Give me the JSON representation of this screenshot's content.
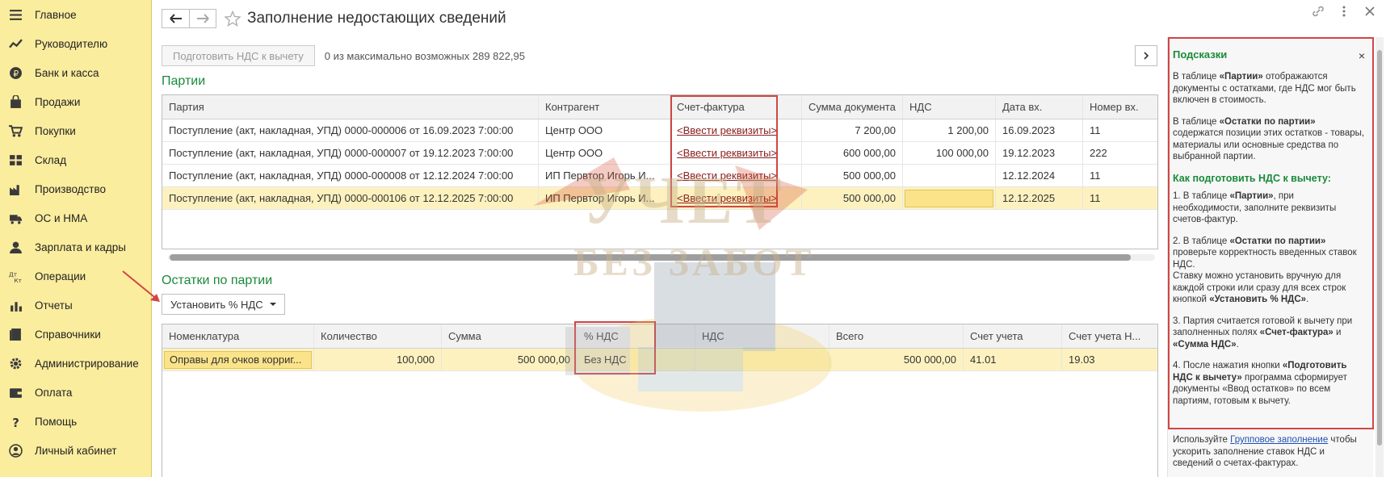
{
  "sidebar": {
    "items": [
      {
        "label": "Главное",
        "icon": "menu-icon"
      },
      {
        "label": "Руководителю",
        "icon": "trend-icon"
      },
      {
        "label": "Банк и касса",
        "icon": "ruble-icon"
      },
      {
        "label": "Продажи",
        "icon": "bag-icon"
      },
      {
        "label": "Покупки",
        "icon": "cart-icon"
      },
      {
        "label": "Склад",
        "icon": "warehouse-icon"
      },
      {
        "label": "Производство",
        "icon": "factory-icon"
      },
      {
        "label": "ОС и НМА",
        "icon": "truck-icon"
      },
      {
        "label": "Зарплата и кадры",
        "icon": "person-icon"
      },
      {
        "label": "Операции",
        "icon": "dt-kt-icon"
      },
      {
        "label": "Отчеты",
        "icon": "bar-chart-icon"
      },
      {
        "label": "Справочники",
        "icon": "book-icon"
      },
      {
        "label": "Администрирование",
        "icon": "gear-icon"
      },
      {
        "label": "Оплата",
        "icon": "wallet-icon"
      },
      {
        "label": "Помощь",
        "icon": "question-icon"
      },
      {
        "label": "Личный кабинет",
        "icon": "account-icon"
      }
    ]
  },
  "header": {
    "title": "Заполнение недостающих сведений"
  },
  "toolbar": {
    "prepare_label": "Подготовить НДС к вычету",
    "hint": "0 из максимально возможных 289 822,95"
  },
  "batches": {
    "title": "Партии",
    "columns": [
      "Партия",
      "Контрагент",
      "Счет-фактура",
      "Сумма документа",
      "НДС",
      "Дата вх.",
      "Номер вх."
    ],
    "rows": [
      {
        "party": "Поступление (акт, накладная, УПД) 0000-000006 от 16.09.2023 7:00:00",
        "counterparty": "Центр ООО",
        "invoice": "<Ввести реквизиты>",
        "amount": "7 200,00",
        "vat": "1 200,00",
        "date": "16.09.2023",
        "number": "11"
      },
      {
        "party": "Поступление (акт, накладная, УПД) 0000-000007 от 19.12.2023 7:00:00",
        "counterparty": "Центр ООО",
        "invoice": "<Ввести реквизиты>",
        "amount": "600 000,00",
        "vat": "100 000,00",
        "date": "19.12.2023",
        "number": "222"
      },
      {
        "party": "Поступление (акт, накладная, УПД) 0000-000008 от 12.12.2024 7:00:00",
        "counterparty": "ИП Первтор Игорь И...",
        "invoice": "<Ввести реквизиты>",
        "amount": "500 000,00",
        "vat": "",
        "date": "12.12.2024",
        "number": "11"
      },
      {
        "party": "Поступление (акт, накладная, УПД) 0000-000106 от 12.12.2025 7:00:00",
        "counterparty": "ИП Первтор Игорь И...",
        "invoice": "<Ввести реквизиты>",
        "amount": "500 000,00",
        "vat": "",
        "date": "12.12.2025",
        "number": "11"
      }
    ]
  },
  "remains": {
    "title": "Остатки по партии",
    "set_vat_label": "Установить % НДС",
    "columns": [
      "Номенклатура",
      "Количество",
      "Сумма",
      "% НДС",
      "НДС",
      "Всего",
      "Счет учета",
      "Счет учета Н..."
    ],
    "rows": [
      {
        "item": "Оправы для очков корриг...",
        "qty": "100,000",
        "sum": "500 000,00",
        "vat_rate": "Без НДС",
        "vat": "",
        "total": "500 000,00",
        "account": "41.01",
        "account_vat": "19.03"
      }
    ]
  },
  "watermark": {
    "line1": "УЧЕТ",
    "line2": "БЕЗ ЗАБОТ"
  },
  "hints": {
    "title": "Подсказки",
    "close": "×",
    "p1_a": "В таблице ",
    "p1_b": "«Партии»",
    "p1_c": " отображаются документы с остатками, где НДС мог быть включен в стоимость.",
    "p2_a": "В таблице ",
    "p2_b": "«Остатки по партии»",
    "p2_c": " содержатся позиции этих остатков - товары, материалы или основные средства по выбранной партии.",
    "sub": "Как подготовить НДС к вычету:",
    "s1_a": "1. В таблице ",
    "s1_b": "«Партии»",
    "s1_c": ", при необходимости, заполните реквизиты счетов-фактур.",
    "s2_a": "2. В таблице ",
    "s2_b": "«Остатки по партии»",
    "s2_c": " проверьте корректность введенных ставок НДС.",
    "s2_d": "Ставку можно установить вручную для каждой строки или сразу для всех строк кнопкой ",
    "s2_e": "«Установить % НДС»",
    "s2_f": ".",
    "s3_a": "3. Партия считается готовой к вычету при заполненных полях ",
    "s3_b": "«Счет-фактура»",
    "s3_c": " и ",
    "s3_d": "«Сумма НДС»",
    "s3_e": ".",
    "s4_a": "4. После нажатия кнопки ",
    "s4_b": "«Подготовить НДС к вычету»",
    "s4_c": " программа сформирует документы «Ввод остатков» по всем партиям, готовым к вычету.",
    "foot_a": "Используйте ",
    "foot_link": "Групповое заполнение",
    "foot_b": " чтобы ускорить заполнение ставок НДС и сведений о счетах-фактурах."
  }
}
